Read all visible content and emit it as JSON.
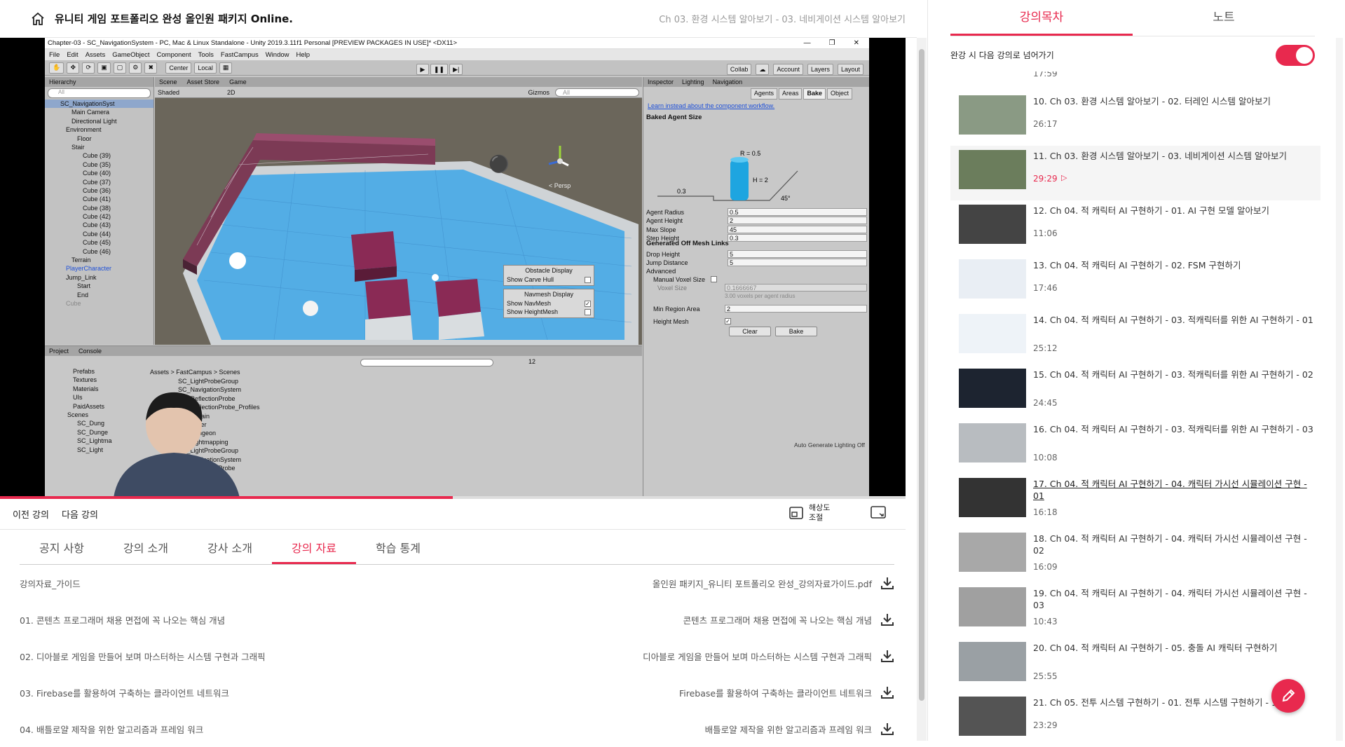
{
  "header": {
    "course_title": "유니티 게임 포트폴리오 완성 올인원 패키지 Online.",
    "chapter_crumb": "Ch 03. 환경 시스템 알아보기 - 03. 네비게이션 시스템 알아보기"
  },
  "video": {
    "progress_percent": 50,
    "unity": {
      "window_title": "Chapter-03 - SC_NavigationSystem - PC, Mac & Linux Standalone - Unity 2019.3.11f1 Personal [PREVIEW PACKAGES IN USE]* <DX11>",
      "menu": [
        "File",
        "Edit",
        "Assets",
        "GameObject",
        "Component",
        "Tools",
        "FastCampus",
        "Window",
        "Help"
      ],
      "toolbar": {
        "center": "Center",
        "local": "Local",
        "collab": "Collab",
        "account": "Account",
        "layers": "Layers",
        "layout": "Layout"
      },
      "hierarchy": {
        "tab": "Hierarchy",
        "search": "All",
        "rows": [
          {
            "label": "SC_NavigationSyst",
            "indent": 0,
            "style": "sel"
          },
          {
            "label": "Main Camera",
            "indent": 2,
            "style": ""
          },
          {
            "label": "Directional Light",
            "indent": 2,
            "style": ""
          },
          {
            "label": "Environment",
            "indent": 1,
            "style": ""
          },
          {
            "label": "Floor",
            "indent": 3,
            "style": ""
          },
          {
            "label": "Stair",
            "indent": 2,
            "style": ""
          },
          {
            "label": "Cube (39)",
            "indent": 4,
            "style": ""
          },
          {
            "label": "Cube (35)",
            "indent": 4,
            "style": ""
          },
          {
            "label": "Cube (40)",
            "indent": 4,
            "style": ""
          },
          {
            "label": "Cube (37)",
            "indent": 4,
            "style": ""
          },
          {
            "label": "Cube (36)",
            "indent": 4,
            "style": ""
          },
          {
            "label": "Cube (41)",
            "indent": 4,
            "style": ""
          },
          {
            "label": "Cube (38)",
            "indent": 4,
            "style": ""
          },
          {
            "label": "Cube (42)",
            "indent": 4,
            "style": ""
          },
          {
            "label": "Cube (43)",
            "indent": 4,
            "style": ""
          },
          {
            "label": "Cube (44)",
            "indent": 4,
            "style": ""
          },
          {
            "label": "Cube (45)",
            "indent": 4,
            "style": ""
          },
          {
            "label": "Cube (46)",
            "indent": 4,
            "style": ""
          },
          {
            "label": "Terrain",
            "indent": 2,
            "style": ""
          },
          {
            "label": "PlayerCharacter",
            "indent": 1,
            "style": "blue"
          },
          {
            "label": "Jump_Link",
            "indent": 1,
            "style": ""
          },
          {
            "label": "Start",
            "indent": 3,
            "style": ""
          },
          {
            "label": "End",
            "indent": 3,
            "style": ""
          },
          {
            "label": "Cube",
            "indent": 1,
            "style": "grey"
          }
        ]
      },
      "scene": {
        "tabs": [
          "Scene",
          "Asset Store",
          "Game"
        ],
        "shading": "Shaded",
        "mode_2d": "2D",
        "gizmos": "Gizmos",
        "search": "All",
        "persp": "< Persp",
        "obstacle_display": {
          "title": "Obstacle Display",
          "show_carve_hull": "Show Carve Hull"
        },
        "navmesh_display": {
          "title": "Navmesh Display",
          "show_navmesh": "Show NavMesh",
          "show_heightmesh": "Show HeightMesh"
        }
      },
      "inspector": {
        "tabs": [
          "Inspector",
          "Lighting",
          "Navigation"
        ],
        "subtabs": [
          "Agents",
          "Areas",
          "Bake",
          "Object"
        ],
        "link": "Learn instead about the component workflow.",
        "baked_agent_size": "Baked Agent Size",
        "diagram": {
          "r": "R = 0.5",
          "h": "H = 2",
          "step": "0.3",
          "slope": "45°"
        },
        "fields": [
          {
            "label": "Agent Radius",
            "value": "0.5"
          },
          {
            "label": "Agent Height",
            "value": "2"
          },
          {
            "label": "Max Slope",
            "value": "45"
          },
          {
            "label": "Step Height",
            "value": "0.3"
          }
        ],
        "offmesh_title": "Generated Off Mesh Links",
        "offmesh": [
          {
            "label": "Drop Height",
            "value": "5"
          },
          {
            "label": "Jump Distance",
            "value": "5"
          }
        ],
        "advanced": "Advanced",
        "manual_voxel": "Manual Voxel Size",
        "voxel_size": "Voxel Size",
        "voxel_value": "0.1666667",
        "voxel_hint": "3.00 voxels per agent radius",
        "min_region": "Min Region Area",
        "min_region_value": "2",
        "height_mesh": "Height Mesh",
        "clear": "Clear",
        "bake": "Bake",
        "status": "Auto Generate Lighting Off"
      },
      "project": {
        "tabs": [
          "Project",
          "Console"
        ],
        "count": "12",
        "breadcrumb": [
          "Assets",
          "FastCampus",
          "Scenes"
        ],
        "tree": [
          "Prefabs",
          "Textures",
          "Materials",
          "UIs",
          "PaidAssets",
          "Scenes",
          "SC_Dung",
          "SC_Dunge",
          "SC_Lightma",
          "SC_Light"
        ],
        "files": [
          "SC_LightProbeGroup",
          "SC_NavigationSystem",
          "SC_ReflectionProbe",
          "SC_ReflectionProbe_Profiles",
          "SC_Terrain",
          "NewLayer",
          "SC_Dungeon",
          "SC_Lightmapping",
          "SC_LightProbeGroup",
          "SC_NavigationSystem",
          "SC_ReflectionProbe",
          "SC_Terrain"
        ]
      }
    }
  },
  "nav": {
    "prev": "이전 강의",
    "next": "다음 강의",
    "resolution": "해상도\n조절"
  },
  "tabs": [
    "공지 사항",
    "강의 소개",
    "강사 소개",
    "강의 자료",
    "학습 통계"
  ],
  "active_tab": 3,
  "resources": [
    {
      "name": "강의자료_가이드",
      "file": "올인원 패키지_유니티 포트폴리오 완성_강의자료가이드.pdf"
    },
    {
      "name": "01. 콘텐츠 프로그래머 채용 면접에 꼭 나오는 핵심 개념",
      "file": "콘텐츠 프로그래머 채용 면접에 꼭 나오는 핵심 개념"
    },
    {
      "name": "02. 디아블로 게임을 만들어 보며 마스터하는 시스템 구현과 그래픽",
      "file": "디아블로 게임을 만들어 보며 마스터하는 시스템 구현과 그래픽"
    },
    {
      "name": "03. Firebase를 활용하여 구축하는 클라이언트 네트워크",
      "file": "Firebase를 활용하여 구축하는 클라이언트 네트워크"
    },
    {
      "name": "04. 배틀로얄 제작을 위한 알고리즘과 프레임 워크",
      "file": "배틀로얄 제작을 위한 알고리즘과 프레임 워크"
    }
  ],
  "sidebar": {
    "tabs": [
      "강의목차",
      "노트"
    ],
    "autoplay_label": "완강 시 다음 강의로 넘어가기",
    "autoplay_on": true,
    "partial_top_duration": "17:59",
    "lectures": [
      {
        "title": "10. Ch 03. 환경 시스템 알아보기 - 02. 터레인 시스템 알아보기",
        "duration": "26:17",
        "state": "done"
      },
      {
        "title": "11. Ch 03. 환경 시스템 알아보기 - 03. 네비게이션 시스템 알아보기",
        "duration": "29:29",
        "state": "current"
      },
      {
        "title": "12. Ch 04. 적 캐릭터 AI 구현하기 - 01. AI 구현 모델 알아보기",
        "duration": "11:06",
        "state": ""
      },
      {
        "title": "13. Ch 04. 적 캐릭터 AI 구현하기 - 02. FSM 구현하기",
        "duration": "17:46",
        "state": ""
      },
      {
        "title": "14. Ch 04. 적 캐릭터 AI 구현하기 - 03. 적캐릭터를 위한 AI 구현하기 - 01",
        "duration": "25:12",
        "state": ""
      },
      {
        "title": "15. Ch 04. 적 캐릭터 AI 구현하기 - 03. 적캐릭터를 위한 AI 구현하기 - 02",
        "duration": "24:45",
        "state": ""
      },
      {
        "title": "16. Ch 04. 적 캐릭터 AI 구현하기 - 03. 적캐릭터를 위한 AI 구현하기 - 03",
        "duration": "10:08",
        "state": ""
      },
      {
        "title": "17. Ch 04. 적 캐릭터 AI 구현하기 - 04. 캐릭터 가시선 시뮬레이션 구현 - 01",
        "duration": "16:18",
        "state": "watching"
      },
      {
        "title": "18. Ch 04. 적 캐릭터 AI 구현하기 - 04. 캐릭터 가시선 시뮬레이션 구현 - 02",
        "duration": "16:09",
        "state": ""
      },
      {
        "title": "19. Ch 04. 적 캐릭터 AI 구현하기 - 04. 캐릭터 가시선 시뮬레이션 구현 - 03",
        "duration": "10:43",
        "state": ""
      },
      {
        "title": "20. Ch 04. 적 캐릭터 AI 구현하기 - 05. 충돌 AI 캐릭터 구현하기",
        "duration": "25:55",
        "state": ""
      },
      {
        "title": "21. Ch 05. 전투 시스템 구현하기 - 01. 전투 시스템 구현하기 - 1",
        "duration": "23:29",
        "state": ""
      }
    ]
  },
  "icons": {
    "home": "home-icon",
    "download": "download-icon",
    "resolution": "screen-resize-icon",
    "fullscreen": "fullscreen-icon",
    "edit": "pencil-icon",
    "playing": "play-circle-icon"
  },
  "colors": {
    "accent": "#e8294e",
    "navmesh": "#49a9e6",
    "stair": "#7c3a55"
  }
}
